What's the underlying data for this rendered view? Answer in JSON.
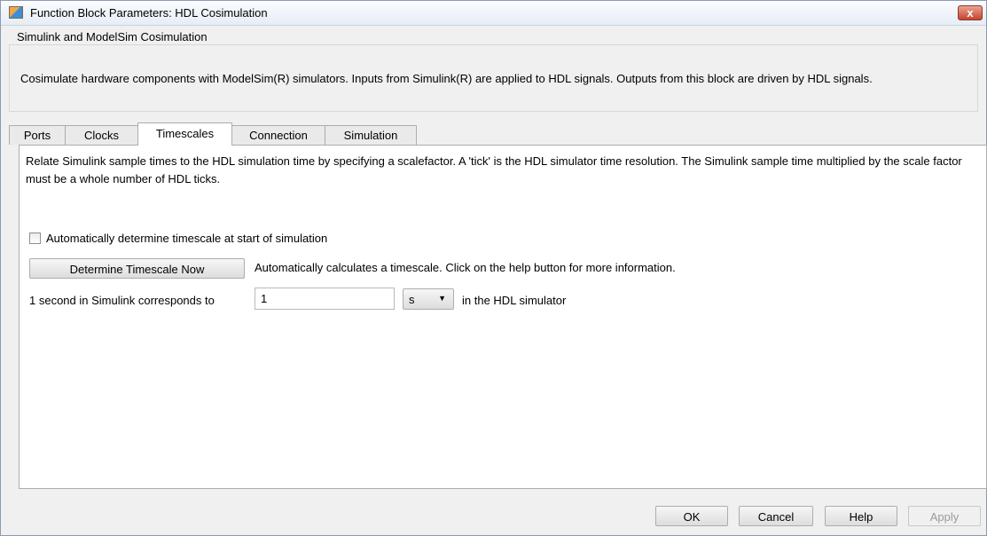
{
  "window": {
    "title": "Function Block Parameters: HDL Cosimulation",
    "close_glyph": "x"
  },
  "group": {
    "title": "Simulink and ModelSim Cosimulation",
    "description": "Cosimulate hardware components with ModelSim(R) simulators. Inputs from Simulink(R) are applied to HDL signals. Outputs from this block are driven by HDL signals."
  },
  "tabs": [
    {
      "label": "Ports",
      "active": false
    },
    {
      "label": "Clocks",
      "active": false
    },
    {
      "label": "Timescales",
      "active": true
    },
    {
      "label": "Connection",
      "active": false
    },
    {
      "label": "Simulation",
      "active": false
    }
  ],
  "timescales": {
    "description": "Relate Simulink sample times to the HDL simulation time by specifying a scalefactor. A 'tick' is the HDL simulator time resolution. The Simulink sample time multiplied by the scale factor must be a whole number of HDL ticks.",
    "auto_checkbox_label": "Automatically determine timescale at start of simulation",
    "auto_checkbox_checked": false,
    "determine_button_label": "Determine Timescale Now",
    "determine_hint": "Automatically calculates a timescale. Click on the help button for more information.",
    "correspondence_label": "1 second in Simulink corresponds to",
    "scale_value": "1",
    "unit_value": "s",
    "unit_arrow": "▼",
    "hdl_label": "in the HDL simulator"
  },
  "footer": {
    "ok_label": "OK",
    "cancel_label": "Cancel",
    "help_label": "Help",
    "apply_label": "Apply"
  },
  "colors": {
    "window_bg": "#f0f0f0",
    "panel_bg": "#ffffff",
    "close_button": "#c6432c"
  }
}
